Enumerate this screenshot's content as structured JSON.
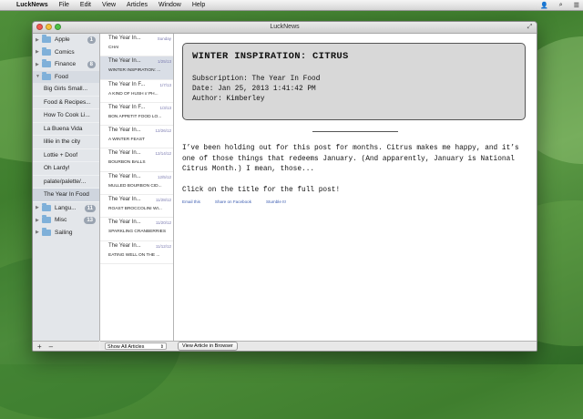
{
  "menubar": {
    "app": "LuckNews",
    "items": [
      "File",
      "Edit",
      "View",
      "Articles",
      "Window",
      "Help"
    ]
  },
  "window": {
    "title": "LuckNews"
  },
  "sidebar": {
    "rows": [
      {
        "kind": "group",
        "label": "Apple",
        "badge": "1"
      },
      {
        "kind": "group",
        "label": "Comics",
        "badge": ""
      },
      {
        "kind": "group",
        "label": "Finance",
        "badge": "8"
      },
      {
        "kind": "group-open",
        "label": "Food",
        "badge": ""
      },
      {
        "kind": "feed",
        "label": "Big Girls Small...",
        "badge": ""
      },
      {
        "kind": "feed",
        "label": "Food & Recipes...",
        "badge": ""
      },
      {
        "kind": "feed",
        "label": "How To Cook Li...",
        "badge": ""
      },
      {
        "kind": "feed",
        "label": "La Buena Vida",
        "badge": ""
      },
      {
        "kind": "feed",
        "label": "lillie in the city",
        "badge": ""
      },
      {
        "kind": "feed",
        "label": "Lottie + Doof",
        "badge": ""
      },
      {
        "kind": "feed",
        "label": "Oh Lardy!",
        "badge": ""
      },
      {
        "kind": "feed",
        "label": "palate/palette/...",
        "badge": ""
      },
      {
        "kind": "feed-selected",
        "label": "The Year In Food",
        "badge": ""
      },
      {
        "kind": "group",
        "label": "Langu...",
        "badge": "11"
      },
      {
        "kind": "group",
        "label": "Misc",
        "badge": "13"
      },
      {
        "kind": "group",
        "label": "Sailing",
        "badge": ""
      }
    ],
    "footer": {
      "add": "+",
      "remove": "–"
    }
  },
  "articles": {
    "items": [
      {
        "source": "The Year In...",
        "date": "Sunday",
        "title": "CHAI"
      },
      {
        "source": "The Year In...",
        "date": "1/25/13",
        "title": "WINTER INSPIRATION: ..."
      },
      {
        "source": "The Year In F...",
        "date": "1/7/13",
        "title": "A KIND OF HUSH // PH..."
      },
      {
        "source": "The Year In F...",
        "date": "1/3/13",
        "title": "BON APPETIT FOOD LO..."
      },
      {
        "source": "The Year In...",
        "date": "12/26/12",
        "title": "A WINTER FEAST"
      },
      {
        "source": "The Year In...",
        "date": "12/14/12",
        "title": "BOURBON BALLS"
      },
      {
        "source": "The Year In...",
        "date": "12/5/12",
        "title": "MULLED BOURBON CID..."
      },
      {
        "source": "The Year In...",
        "date": "11/28/12",
        "title": "ROAST BROCCOLINI WI..."
      },
      {
        "source": "The Year In...",
        "date": "11/20/12",
        "title": "SPARKLING CRANBERRIES"
      },
      {
        "source": "The Year In...",
        "date": "11/12/12",
        "title": "EATING WELL ON THE ..."
      }
    ],
    "filter": "Show All Articles"
  },
  "reader": {
    "title": "WINTER INSPIRATION: CITRUS",
    "subscription": "Subscription: The Year In Food",
    "date": "Date: Jan 25, 2013 1:41:42 PM",
    "author": "Author: Kimberley",
    "body": "I’ve been holding out for this post for months. Citrus makes me happy, and it’s one of those things that redeems January. (And apparently, January is National Citrus Month.) I mean, those...",
    "cta": "Click on the title for the full post!",
    "share": [
      "Email this",
      "Share on Facebook",
      "Stumble It!"
    ],
    "browser_button": "View Article in Browser"
  }
}
